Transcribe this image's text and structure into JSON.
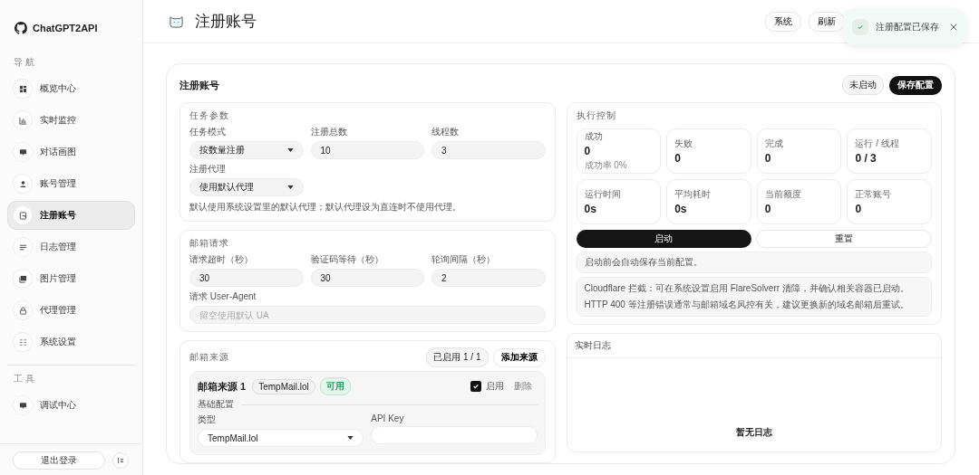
{
  "sidebar": {
    "brand": "ChatGPT2API",
    "sections": [
      {
        "heading": "导 航",
        "items": [
          {
            "label": "概览中心",
            "selected": false
          },
          {
            "label": "实时监控",
            "selected": false
          },
          {
            "label": "对话画图",
            "selected": false
          },
          {
            "label": "账号管理",
            "selected": false
          },
          {
            "label": "注册账号",
            "selected": true
          },
          {
            "label": "日志管理",
            "selected": false
          },
          {
            "label": "图片管理",
            "selected": false
          },
          {
            "label": "代理管理",
            "selected": false
          },
          {
            "label": "系统设置",
            "selected": false
          }
        ]
      },
      {
        "heading": "工 具",
        "items": [
          {
            "label": "调试中心",
            "selected": false
          }
        ]
      }
    ],
    "logout": "退出登录"
  },
  "header": {
    "title": "注册账号",
    "buttons": [
      "系统",
      "刷新"
    ]
  },
  "toast": {
    "message": "注册配置已保存"
  },
  "card": {
    "title": "注册账号",
    "status": "未启动",
    "save_button": "保存配置",
    "task_params": {
      "heading": "任务参数",
      "rows": [
        [
          {
            "kind": "select",
            "label": "任务模式",
            "value": "按数量注册"
          },
          {
            "kind": "input",
            "label": "注册总数",
            "value": "10"
          },
          {
            "kind": "input",
            "label": "线程数",
            "value": "3"
          }
        ],
        [
          {
            "kind": "select",
            "label": "注册代理",
            "value": "使用默认代理"
          }
        ]
      ],
      "hint": "默认使用系统设置里的默认代理；默认代理设为直连时不使用代理。"
    },
    "mail_request": {
      "heading": "邮箱请求",
      "rows": [
        [
          {
            "kind": "input",
            "label": "请求超时（秒）",
            "value": "30"
          },
          {
            "kind": "input",
            "label": "验证码等待（秒）",
            "value": "30"
          },
          {
            "kind": "input",
            "label": "轮询间隔（秒）",
            "value": "2"
          }
        ],
        [
          {
            "kind": "input",
            "label": "请求 User-Agent",
            "placeholder": "留空使用默认 UA"
          }
        ]
      ]
    },
    "mail_sources": {
      "heading": "邮箱来源",
      "enabled_count": "已启用 1 / 1",
      "add_button": "添加来源",
      "sources": [
        {
          "title": "邮箱来源 1",
          "provider": "TempMail.lol",
          "status": "可用",
          "enabled": true,
          "enable_label": "启用",
          "delete_button": "删除",
          "section_label": "基础配置",
          "fields": [
            {
              "kind": "select",
              "label": "类型",
              "value": "TempMail.lol"
            },
            {
              "kind": "input",
              "label": "API Key"
            }
          ]
        }
      ]
    },
    "control": {
      "heading": "执行控制",
      "stats": [
        {
          "label": "成功",
          "value": "0",
          "sub": "成功率 0%"
        },
        {
          "label": "失败",
          "value": "0"
        },
        {
          "label": "完成",
          "value": "0"
        },
        {
          "label": "运行 / 线程",
          "value": "0 / 3"
        },
        {
          "label": "运行时间",
          "value": "0s"
        },
        {
          "label": "平均耗时",
          "value": "0s"
        },
        {
          "label": "当前额度",
          "value": "0"
        },
        {
          "label": "正常账号",
          "value": "0"
        }
      ],
      "start_button": "启动",
      "reset_button": "重置",
      "note": "启动前会自动保存当前配置。",
      "tips": [
        "Cloudflare 拦截：可在系统设置启用 FlareSolverr 清障，并确认相关容器已启动。",
        "HTTP 400 等注册错误通常与邮箱域名风控有关，建议更换新的域名邮箱后重试。"
      ]
    },
    "log": {
      "heading": "实时日志",
      "empty": "暂无日志"
    }
  }
}
